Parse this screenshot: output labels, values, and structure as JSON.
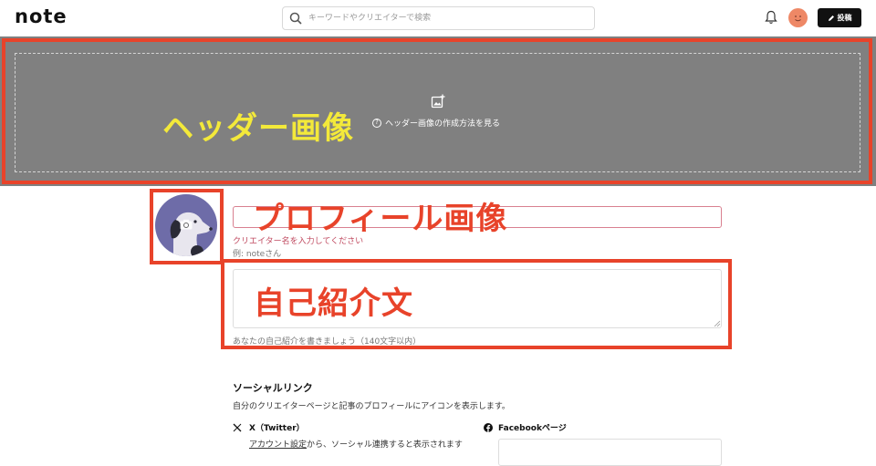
{
  "topbar": {
    "logo": "note",
    "search_placeholder": "キーワードやクリエイターで検索",
    "post_label": "投稿"
  },
  "header": {
    "annotation": "ヘッダー画像",
    "howto_label": "ヘッダー画像の作成方法を見る"
  },
  "profile": {
    "annotation": "プロフィール画像",
    "name_value": "",
    "name_error": "クリエイター名を入力してください",
    "name_example": "例: noteさん"
  },
  "bio": {
    "annotation": "自己紹介文",
    "value": "",
    "hint": "あなたの自己紹介を書きましょう（140文字以内）"
  },
  "social": {
    "title": "ソーシャルリンク",
    "description": "自分のクリエイターページと記事のプロフィールにアイコンを表示します。",
    "x_label": "X（Twitter）",
    "x_link": "アカウント設定",
    "x_note": "から、ソーシャル連携すると表示されます",
    "facebook_label": "Facebookページ"
  },
  "colors": {
    "annotation_red": "#e8432a",
    "annotation_yellow": "#f3e93a",
    "header_gray": "#808080",
    "error_pink": "#c04a60"
  }
}
